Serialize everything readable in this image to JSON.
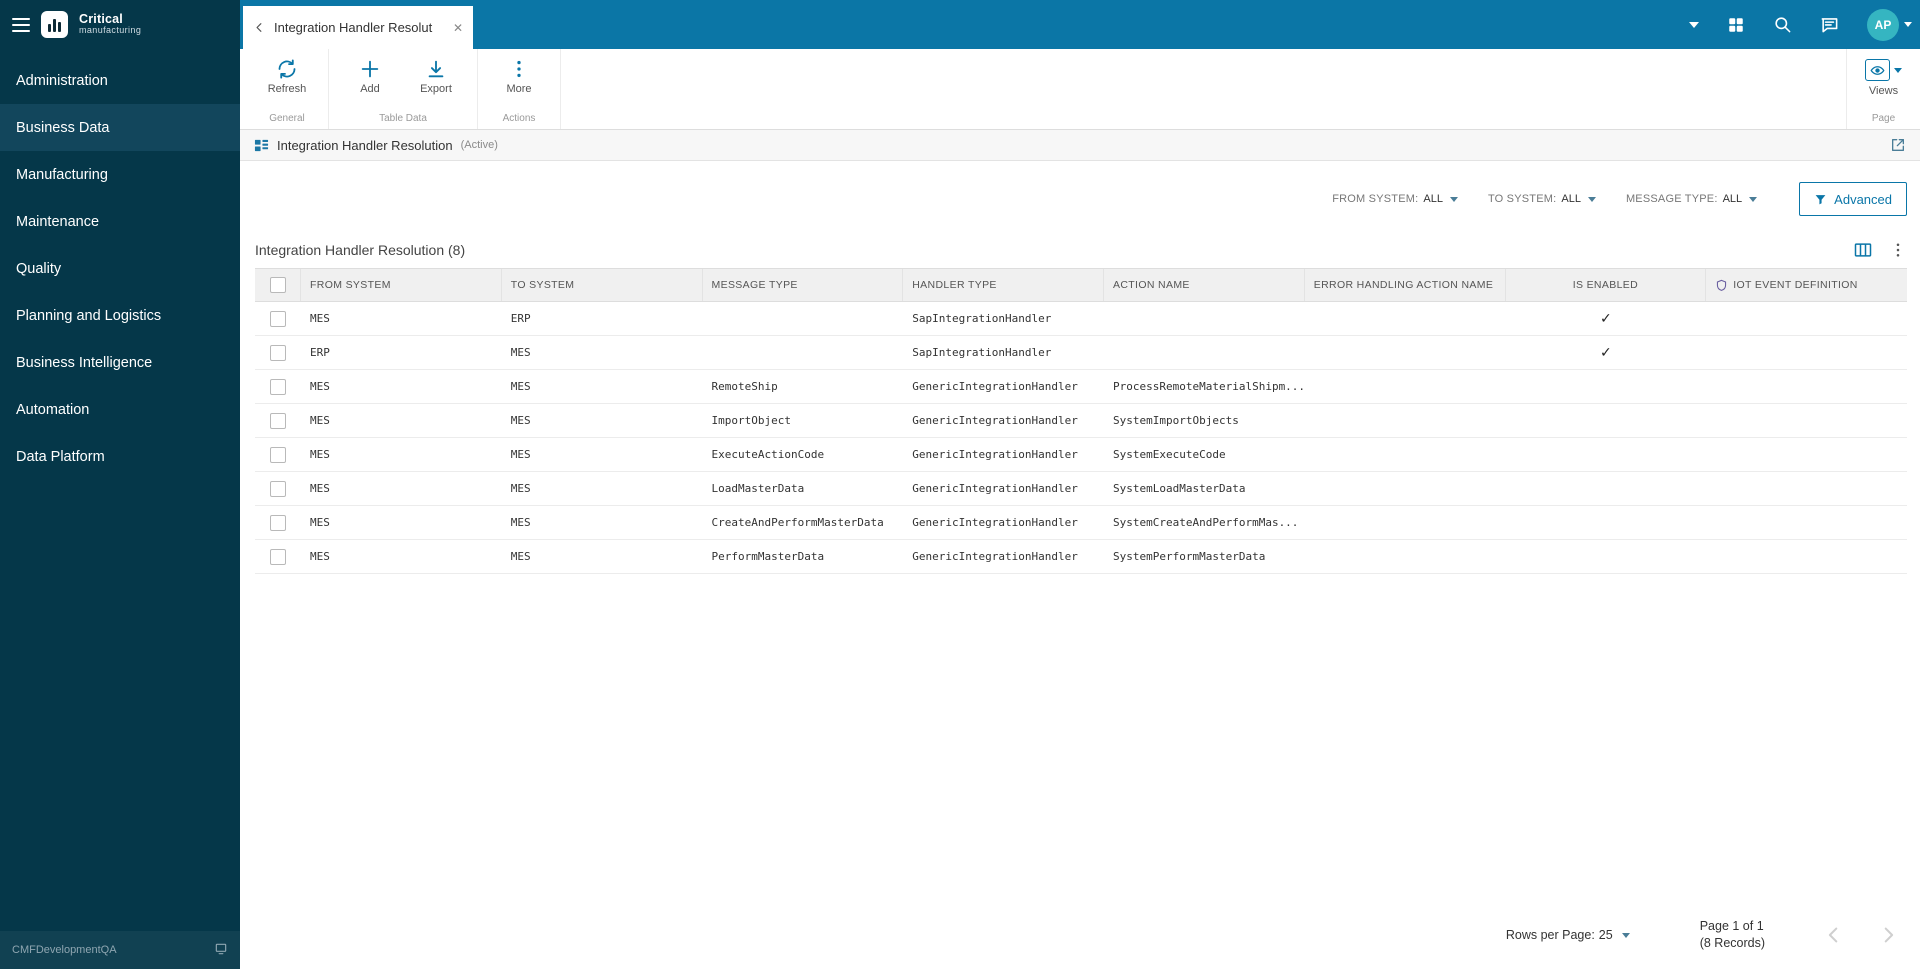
{
  "colors": {
    "topbar": "#0b76a6",
    "sidebar": "#053749",
    "accent": "#0a76a8",
    "avatar_bg": "#35b5c1"
  },
  "brand": {
    "title": "Critical",
    "subtitle": "manufacturing"
  },
  "sidebar": {
    "items": [
      {
        "label": "Administration",
        "active": false
      },
      {
        "label": "Business Data",
        "active": true
      },
      {
        "label": "Manufacturing",
        "active": false
      },
      {
        "label": "Maintenance",
        "active": false
      },
      {
        "label": "Quality",
        "active": false
      },
      {
        "label": "Planning and Logistics",
        "active": false
      },
      {
        "label": "Business Intelligence",
        "active": false
      },
      {
        "label": "Automation",
        "active": false
      },
      {
        "label": "Data Platform",
        "active": false
      }
    ],
    "environment": "CMFDevelopmentQA"
  },
  "topbar": {
    "tab_label": "Integration Handler Resolut",
    "avatar_initials": "AP"
  },
  "toolbar": {
    "groups": [
      {
        "caption": "General",
        "buttons": [
          {
            "label": "Refresh",
            "icon": "refresh"
          }
        ]
      },
      {
        "caption": "Table Data",
        "buttons": [
          {
            "label": "Add",
            "icon": "plus"
          },
          {
            "label": "Export",
            "icon": "export"
          }
        ]
      },
      {
        "caption": "Actions",
        "buttons": [
          {
            "label": "More",
            "icon": "kebab"
          }
        ]
      }
    ],
    "views": {
      "label": "Views",
      "caption": "Page"
    }
  },
  "page_header": {
    "title": "Integration Handler Resolution",
    "status": "(Active)"
  },
  "filter_bar": {
    "filters": [
      {
        "label": "FROM SYSTEM:",
        "value": "ALL"
      },
      {
        "label": "TO SYSTEM:",
        "value": "ALL"
      },
      {
        "label": "MESSAGE TYPE:",
        "value": "ALL"
      }
    ],
    "advanced_label": "Advanced"
  },
  "grid": {
    "title": "Integration Handler Resolution (8)",
    "columns": [
      {
        "key": "from",
        "label": "FROM SYSTEM"
      },
      {
        "key": "to",
        "label": "TO SYSTEM"
      },
      {
        "key": "message",
        "label": "MESSAGE TYPE"
      },
      {
        "key": "handler",
        "label": "HANDLER TYPE"
      },
      {
        "key": "action",
        "label": "ACTION NAME"
      },
      {
        "key": "error",
        "label": "ERROR HANDLING ACTION NAME"
      },
      {
        "key": "enabled",
        "label": "IS ENABLED",
        "align": "center"
      },
      {
        "key": "iot",
        "label": "IOT EVENT DEFINITION",
        "icon": "shield"
      }
    ],
    "rows": [
      {
        "from": "MES",
        "to": "ERP",
        "message": "",
        "handler": "SapIntegrationHandler",
        "action": "",
        "error": "",
        "enabled": true,
        "iot": ""
      },
      {
        "from": "ERP",
        "to": "MES",
        "message": "",
        "handler": "SapIntegrationHandler",
        "action": "",
        "error": "",
        "enabled": true,
        "iot": ""
      },
      {
        "from": "MES",
        "to": "MES",
        "message": "RemoteShip",
        "handler": "GenericIntegrationHandler",
        "action": "ProcessRemoteMaterialShipm...",
        "error": "",
        "enabled": false,
        "iot": ""
      },
      {
        "from": "MES",
        "to": "MES",
        "message": "ImportObject",
        "handler": "GenericIntegrationHandler",
        "action": "SystemImportObjects",
        "error": "",
        "enabled": false,
        "iot": ""
      },
      {
        "from": "MES",
        "to": "MES",
        "message": "ExecuteActionCode",
        "handler": "GenericIntegrationHandler",
        "action": "SystemExecuteCode",
        "error": "",
        "enabled": false,
        "iot": ""
      },
      {
        "from": "MES",
        "to": "MES",
        "message": "LoadMasterData",
        "handler": "GenericIntegrationHandler",
        "action": "SystemLoadMasterData",
        "error": "",
        "enabled": false,
        "iot": ""
      },
      {
        "from": "MES",
        "to": "MES",
        "message": "CreateAndPerformMasterData",
        "handler": "GenericIntegrationHandler",
        "action": "SystemCreateAndPerformMas...",
        "error": "",
        "enabled": false,
        "iot": ""
      },
      {
        "from": "MES",
        "to": "MES",
        "message": "PerformMasterData",
        "handler": "GenericIntegrationHandler",
        "action": "SystemPerformMasterData",
        "error": "",
        "enabled": false,
        "iot": ""
      }
    ]
  },
  "pagination": {
    "rows_per_page_label": "Rows per Page:",
    "rows_per_page_value": "25",
    "page_label": "Page 1 of 1",
    "records_label": "(8 Records)"
  }
}
